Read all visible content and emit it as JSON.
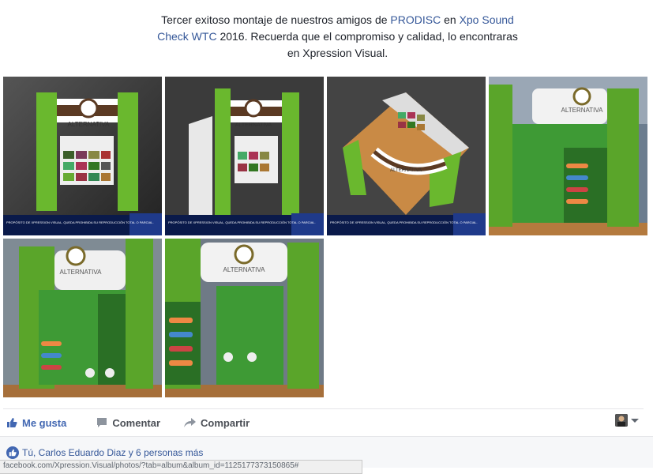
{
  "post": {
    "caption_pre": "Tercer exitoso montaje de nuestros amigos de ",
    "link1": "PRODISC",
    "caption_mid": " en ",
    "link2": "Xpo Sound Check WTC",
    "caption_post": " 2016. Recuerda que el compromiso y calidad, lo encontraras en Xpression Visual."
  },
  "photos": [
    {
      "name": "booth-render-front",
      "brand": "ALTERNATIVA",
      "banner": "PROPÓSITO DE XPRESSION VISUAL, QUEDA PROHIBIDA SU REPRODUCCIÓN TOTAL O PARCIAL."
    },
    {
      "name": "booth-render-side",
      "brand": "ALTERNATIVA",
      "banner": "PROPÓSITO DE XPRESSION VISUAL, QUEDA PROHIBIDA SU REPRODUCCIÓN TOTAL O PARCIAL."
    },
    {
      "name": "booth-render-top",
      "brand": "ALTERNATIVA",
      "banner": "PROPÓSITO DE XPRESSION VISUAL, QUEDA PROHIBIDA SU REPRODUCCIÓN TOTAL O PARCIAL."
    },
    {
      "name": "booth-photo-1",
      "brand": "ALTERNATIVA"
    },
    {
      "name": "booth-photo-2",
      "brand": "ALTERNATIVA"
    },
    {
      "name": "booth-photo-3",
      "brand": "ALTERNATIVA"
    }
  ],
  "actions": {
    "like": "Me gusta",
    "comment": "Comentar",
    "share": "Compartir"
  },
  "reactions": {
    "summary": "Tú, Carlos Eduardo Diaz y 6 personas más"
  },
  "status_bar": {
    "url": "facebook.com/Xpression.Visual/photos/?tab=album&album_id=1125177373150865#"
  },
  "colors": {
    "link": "#365899",
    "like_active": "#4267b2",
    "booth_green": "#6ab82e",
    "booth_brown": "#5b3a23"
  }
}
